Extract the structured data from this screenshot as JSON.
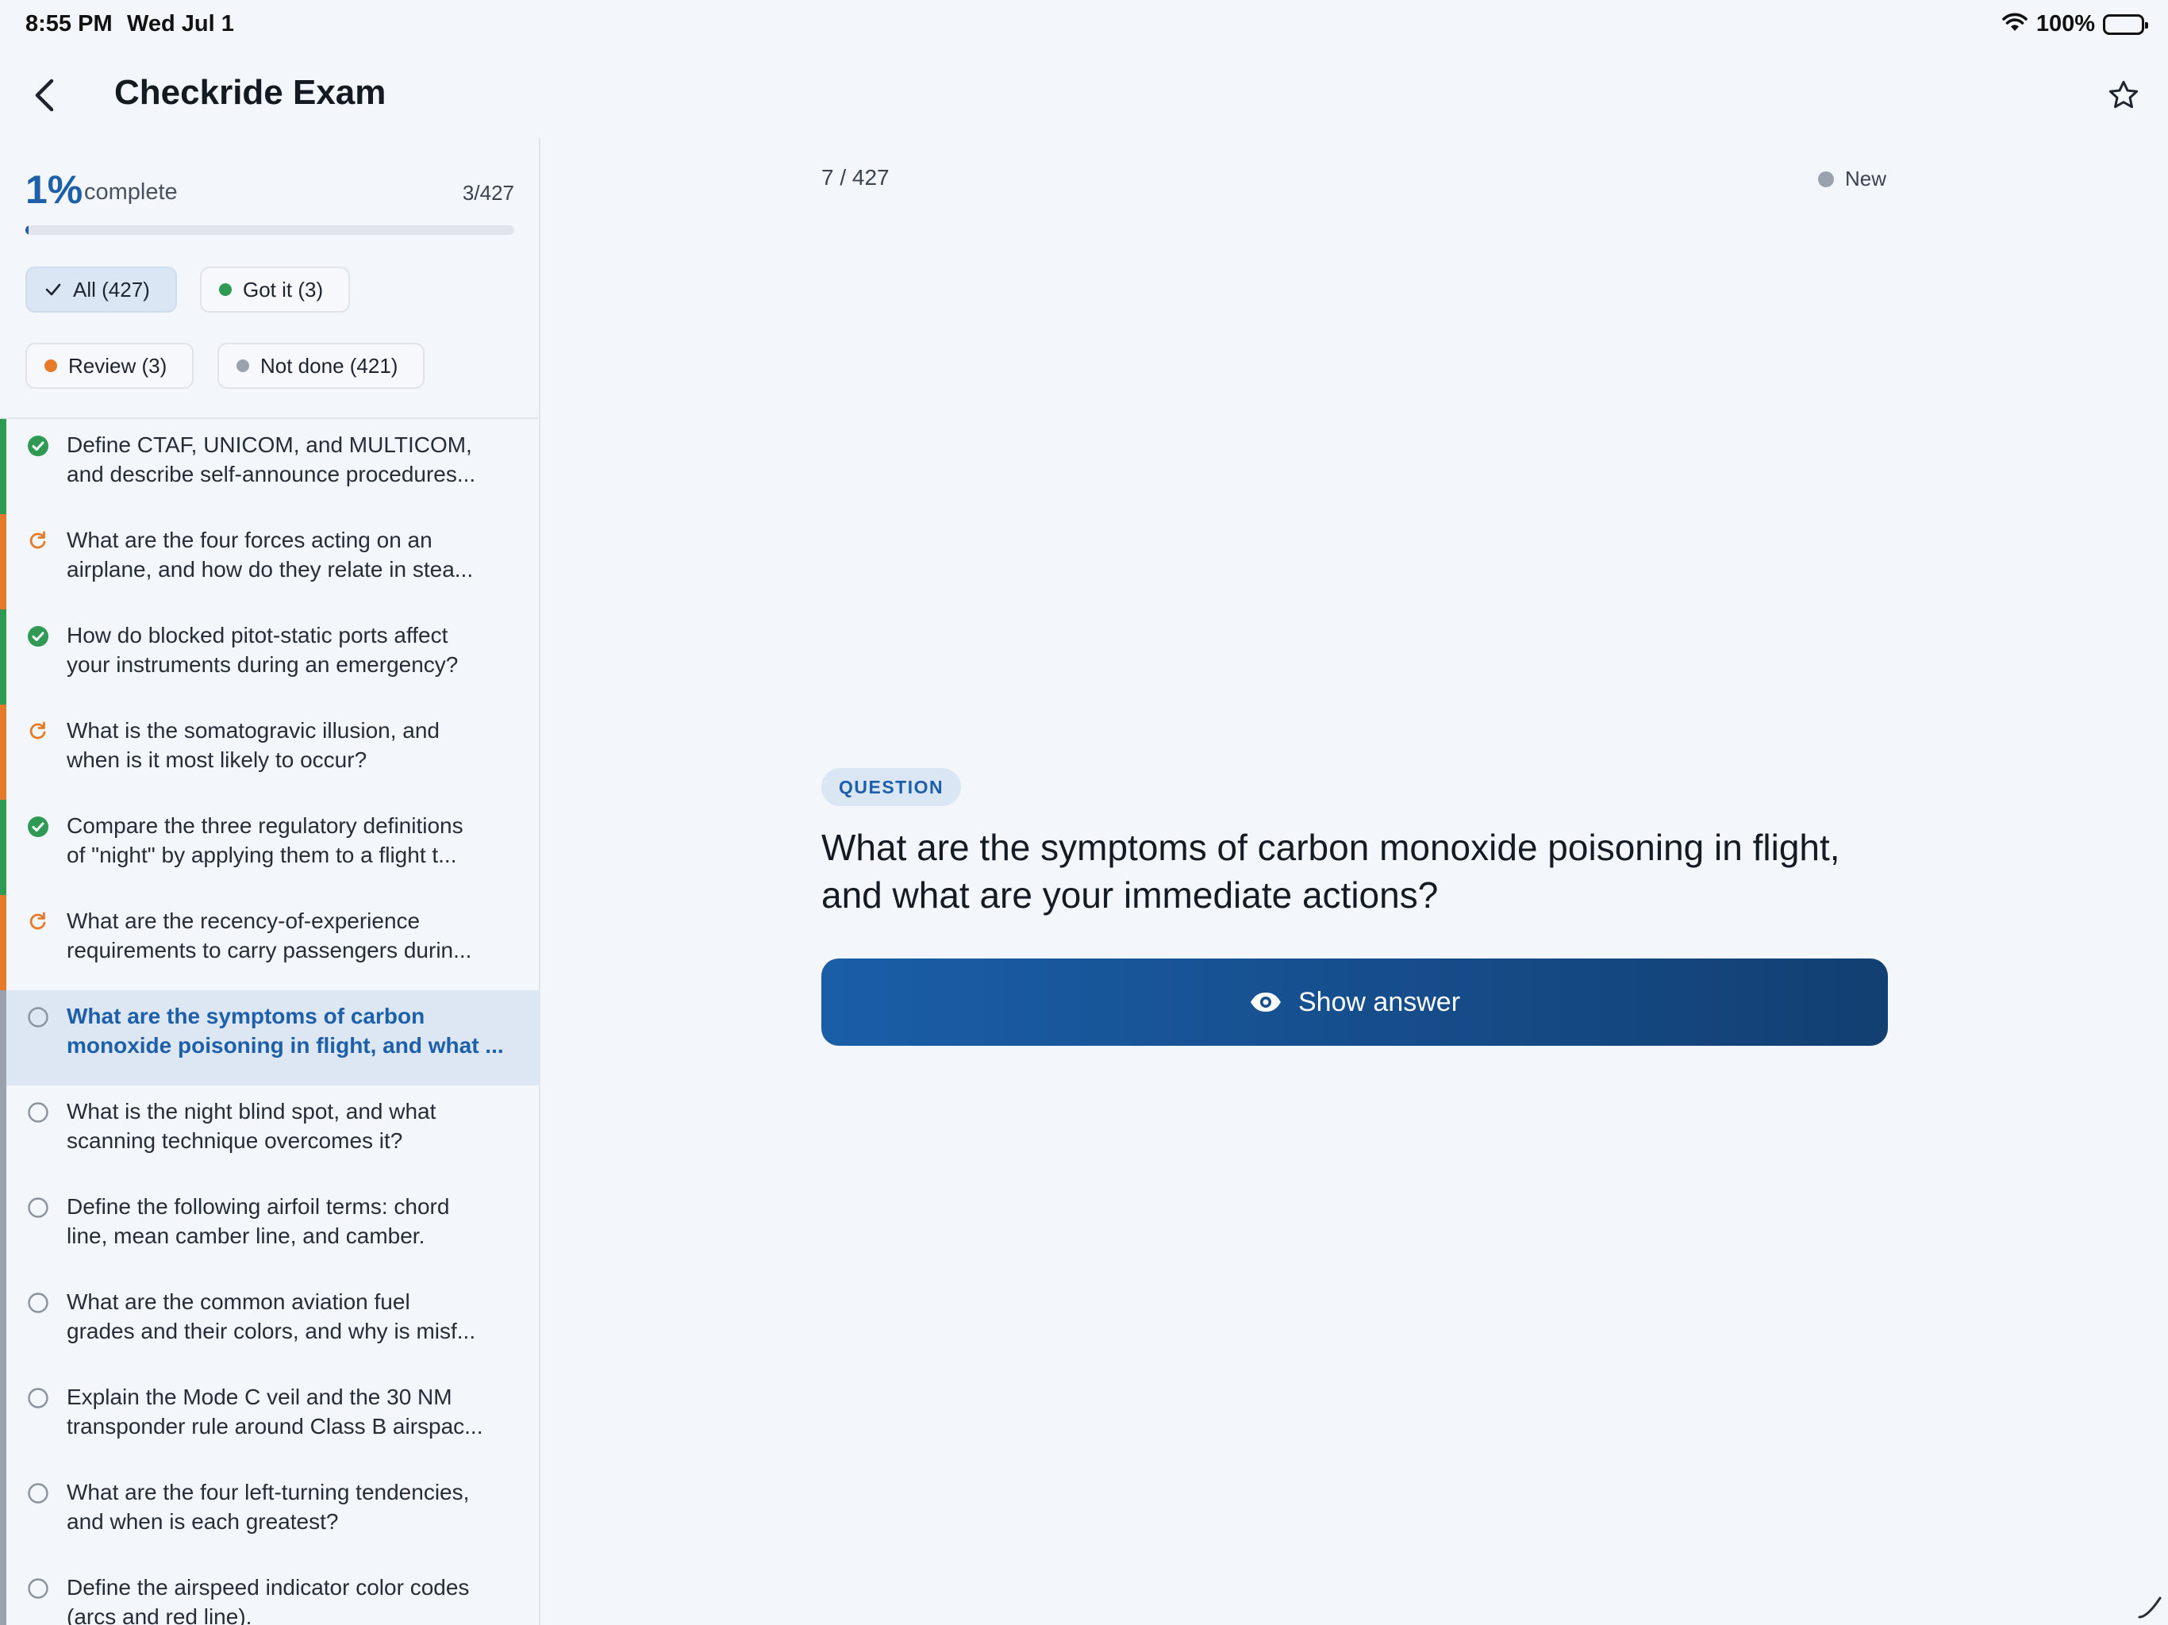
{
  "status_bar": {
    "time": "8:55 PM",
    "date": "Wed Jul 1",
    "battery": "100%"
  },
  "header": {
    "title": "Checkride Exam"
  },
  "progress": {
    "percent": "1%",
    "label": "complete",
    "count": "3/427",
    "fraction": 0.007
  },
  "filters": [
    {
      "label": "All (427)",
      "icon": "check-icon",
      "active": true
    },
    {
      "label": "Got it (3)",
      "dot_color": "#2e9a53"
    },
    {
      "label": "Review (3)",
      "dot_color": "#e67a2b"
    },
    {
      "label": "Not done (421)",
      "dot_color": "#9aa2ad"
    }
  ],
  "colors": {
    "accent": "#1d5fa8",
    "got_it": "#2e9a53",
    "review": "#e67a2b",
    "not_done": "#9aa2ad"
  },
  "questions": [
    {
      "status": "got-it",
      "line1": "Define CTAF, UNICOM, and MULTICOM,",
      "line2": "and describe self-announce procedures..."
    },
    {
      "status": "review",
      "line1": "What are the four forces acting on an",
      "line2": "airplane, and how do they relate in stea..."
    },
    {
      "status": "got-it",
      "line1": "How do blocked pitot-static ports affect",
      "line2": "your instruments during an emergency?"
    },
    {
      "status": "review",
      "line1": "What is the somatogravic illusion, and",
      "line2": "when is it most likely to occur?"
    },
    {
      "status": "got-it",
      "line1": "Compare the three regulatory definitions",
      "line2": "of \"night\" by applying them to a flight t..."
    },
    {
      "status": "review",
      "line1": "What are the recency-of-experience",
      "line2": "requirements to carry passengers durin..."
    },
    {
      "status": "not-done",
      "current": true,
      "line1": "What are the symptoms of carbon",
      "line2": "monoxide poisoning in flight, and what ..."
    },
    {
      "status": "not-done",
      "line1": "What is the night blind spot, and what",
      "line2": "scanning technique overcomes it?"
    },
    {
      "status": "not-done",
      "line1": "Define the following airfoil terms: chord",
      "line2": "line, mean camber line, and camber."
    },
    {
      "status": "not-done",
      "line1": "What are the common aviation fuel",
      "line2": "grades and their colors, and why is misf..."
    },
    {
      "status": "not-done",
      "line1": "Explain the Mode C veil and the 30 NM",
      "line2": "transponder rule around Class B airspac..."
    },
    {
      "status": "not-done",
      "line1": "What are the four left-turning tendencies,",
      "line2": "and when is each greatest?"
    },
    {
      "status": "not-done",
      "line1": "Define the airspeed indicator color codes",
      "line2": "(arcs and red line)."
    }
  ],
  "card": {
    "position": "7 / 427",
    "state": "New",
    "pill": "QUESTION",
    "question": "What are the symptoms of carbon monoxide poisoning in flight, and what are your immediate actions?",
    "show_answer": "Show answer"
  }
}
